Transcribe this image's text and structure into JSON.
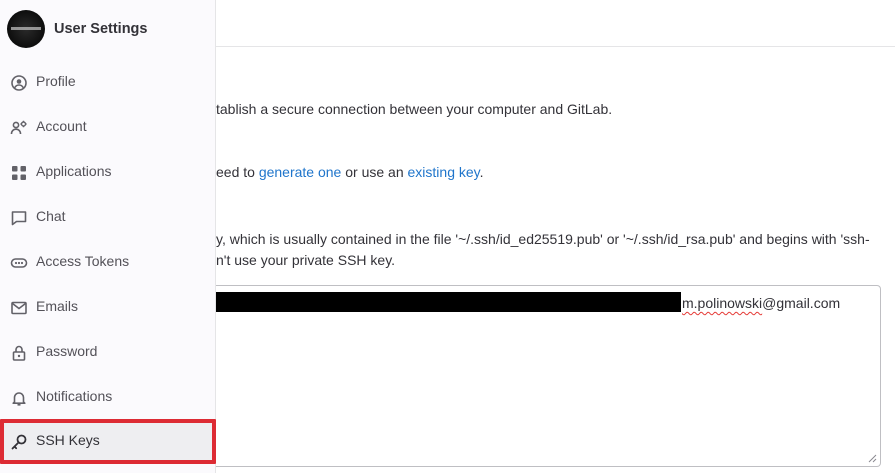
{
  "sidebar": {
    "title": "User Settings",
    "items": [
      {
        "label": "Profile",
        "icon": "profile-icon"
      },
      {
        "label": "Account",
        "icon": "account-icon"
      },
      {
        "label": "Applications",
        "icon": "applications-icon"
      },
      {
        "label": "Chat",
        "icon": "chat-icon"
      },
      {
        "label": "Access Tokens",
        "icon": "token-icon"
      },
      {
        "label": "Emails",
        "icon": "mail-icon"
      },
      {
        "label": "Password",
        "icon": "lock-icon"
      },
      {
        "label": "Notifications",
        "icon": "bell-icon"
      },
      {
        "label": "SSH Keys",
        "icon": "key-icon",
        "active": true
      }
    ]
  },
  "main": {
    "intro": "tablish a secure connection between your computer and GitLab.",
    "need_prefix": "eed to ",
    "generate_link": "generate one",
    "need_middle": " or use an ",
    "existing_link": "existing key",
    "need_suffix": ".",
    "key_help_line1": "y, which is usually contained in the file '~/.ssh/id_ed25519.pub' or '~/.ssh/id_rsa.pub' and begins with 'ssh-",
    "key_help_line2": "n't use your private SSH key.",
    "key_value_visible_prefix": "m.polinowski",
    "key_value_visible_suffix": "@gmail.com"
  },
  "colors": {
    "link": "#1f75cb",
    "highlight": "#dd2b34",
    "sidebar_bg": "#fbfafd"
  }
}
